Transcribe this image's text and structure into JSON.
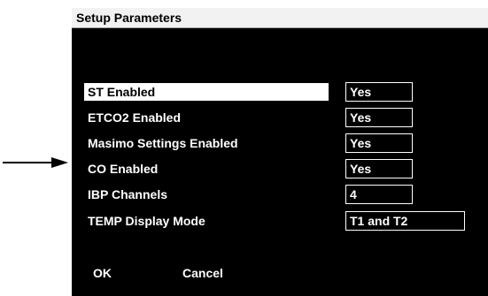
{
  "dialog": {
    "title": "Setup Parameters",
    "rows": [
      {
        "label": "ST Enabled",
        "value": "Yes"
      },
      {
        "label": "ETCO2 Enabled",
        "value": "Yes"
      },
      {
        "label": "Masimo Settings Enabled",
        "value": "Yes"
      },
      {
        "label": "CO Enabled",
        "value": "Yes"
      },
      {
        "label": "IBP Channels",
        "value": "4"
      },
      {
        "label": "TEMP Display Mode",
        "value": "T1 and T2"
      }
    ],
    "ok_label": "OK",
    "cancel_label": "Cancel"
  },
  "colors": {
    "background": "#000000",
    "text": "#ffffff",
    "highlight": "#ffffff",
    "titlebar": "#f2f2f2"
  },
  "annotation": {
    "pointer": "arrow-right-icon"
  }
}
